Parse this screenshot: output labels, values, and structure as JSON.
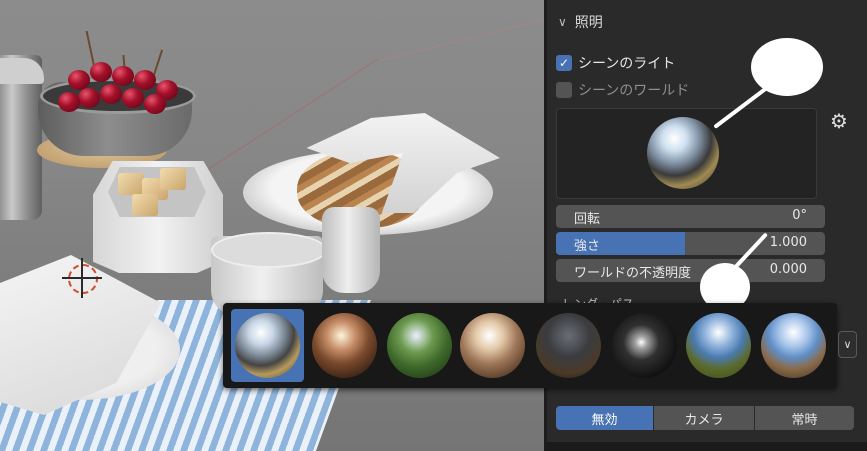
{
  "lighting": {
    "section_title": "照明",
    "scene_lights": {
      "label": "シーンのライト",
      "checked": true
    },
    "scene_world": {
      "label": "シーンのワールド",
      "checked": false
    },
    "hdri_selected": "hdri-1",
    "rotation": {
      "label": "回転",
      "value": "0°"
    },
    "strength": {
      "label": "強さ",
      "value": "1.000",
      "fill_fraction": 0.48
    },
    "world_opacity": {
      "label": "ワールドの不透明度",
      "value": "0.000"
    },
    "render_pass_label": "レンダーパス",
    "hdri_options": [
      {
        "name": "hdri-1",
        "active": true
      },
      {
        "name": "hdri-2",
        "active": false
      },
      {
        "name": "hdri-3",
        "active": false
      },
      {
        "name": "hdri-4",
        "active": false
      },
      {
        "name": "hdri-5",
        "active": false
      },
      {
        "name": "hdri-6",
        "active": false
      },
      {
        "name": "hdri-7",
        "active": false
      },
      {
        "name": "hdri-8",
        "active": false
      }
    ],
    "world_space_lighting": {
      "options": [
        "無効",
        "カメラ",
        "常時"
      ],
      "selected": "無効"
    }
  },
  "colors": {
    "accent": "#4772b3",
    "panel_bg": "#2a2a2a",
    "field_bg": "#545454"
  }
}
